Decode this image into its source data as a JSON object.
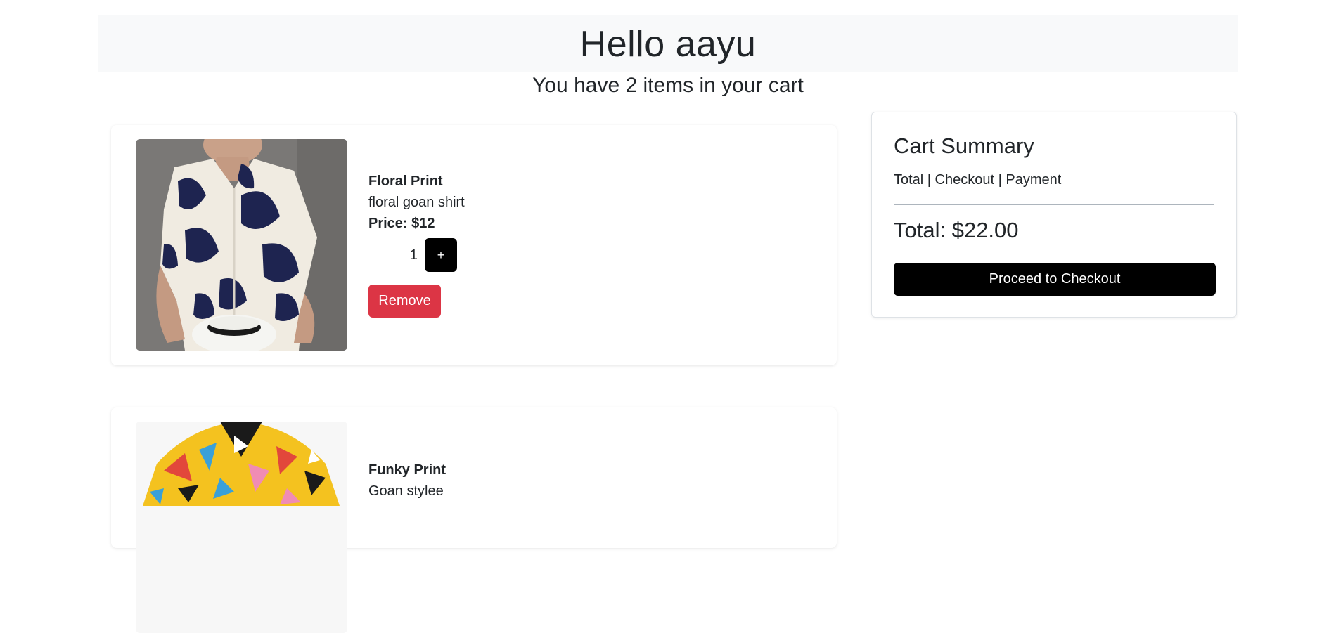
{
  "header": {
    "greeting": "Hello aayu"
  },
  "cart": {
    "count_text": "You have 2 items in your cart"
  },
  "items": [
    {
      "name": "Floral Print",
      "description": "floral goan shirt",
      "price": "Price: $12",
      "quantity": "1",
      "plus_label": "+",
      "remove_label": "Remove",
      "image": "floral-shirt-photo"
    },
    {
      "name": "Funky Print",
      "description": "Goan stylee",
      "image": "funky-shirt-photo"
    }
  ],
  "summary": {
    "title": "Cart Summary",
    "subtitle": "Total | Checkout | Payment",
    "total": "Total: $22.00",
    "checkout_label": "Proceed to Checkout"
  },
  "colors": {
    "header_bg": "#f8f9fa",
    "remove": "#dc3545",
    "primary_button": "#000000"
  }
}
